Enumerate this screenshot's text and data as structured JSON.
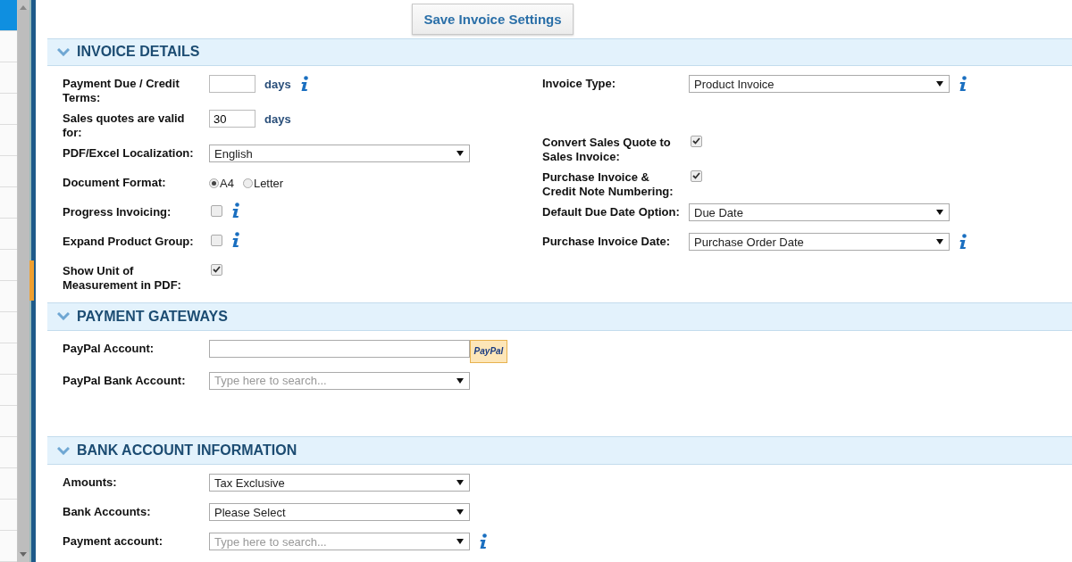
{
  "side_list": {
    "items": [
      {
        "selected": true
      },
      {
        "selected": false
      },
      {
        "selected": false
      },
      {
        "selected": false
      },
      {
        "selected": false
      },
      {
        "selected": false
      },
      {
        "selected": false
      },
      {
        "selected": false
      },
      {
        "selected": false
      },
      {
        "selected": false
      },
      {
        "selected": false
      },
      {
        "selected": false
      },
      {
        "selected": false
      },
      {
        "selected": false
      },
      {
        "selected": false
      },
      {
        "selected": false
      },
      {
        "selected": false
      },
      {
        "selected": false
      }
    ]
  },
  "save_button": "Save Invoice Settings",
  "sections": [
    {
      "title": "INVOICE DETAILS",
      "expanded": true,
      "columns": [
        [
          {
            "kind": "days",
            "label": "Payment Due / Credit Terms:",
            "unit": "days",
            "info": true
          },
          {
            "kind": "days",
            "label": "Sales quotes are valid for:",
            "value": "30",
            "unit": "days"
          },
          {
            "kind": "select",
            "label": "PDF/Excel Localization:",
            "value": "English"
          },
          {
            "kind": "radio",
            "label": "Document Format:",
            "options": [
              {
                "label": "A4",
                "selected": true
              },
              {
                "label": "Letter",
                "selected": false
              }
            ]
          },
          {
            "kind": "checkbox",
            "label": "Progress Invoicing:",
            "checked": false,
            "info": true
          },
          {
            "kind": "checkbox",
            "label": "Expand Product Group:",
            "checked": false,
            "info": true
          },
          {
            "kind": "checkbox",
            "label": "Show Unit of Measurement in PDF:",
            "checked": true
          }
        ],
        [
          {
            "kind": "select",
            "label": "Invoice Type:",
            "value": "Product Invoice",
            "info": true
          },
          {
            "kind": "checkbox",
            "label": "Convert Sales Quote to Sales Invoice:",
            "checked": true
          },
          {
            "kind": "checkbox",
            "label": "Purchase Invoice & Credit Note Numbering:",
            "checked": true
          },
          {
            "kind": "select",
            "label": "Default Due Date Option:",
            "value": "Due Date"
          },
          {
            "kind": "select",
            "label": "Purchase Invoice Date:",
            "value": "Purchase Order Date",
            "info": true
          }
        ]
      ]
    },
    {
      "title": "PAYMENT GATEWAYS",
      "expanded": true,
      "columns": [
        [
          {
            "kind": "paypal",
            "label": "PayPal Account:",
            "badge": "PayPal"
          },
          {
            "kind": "search",
            "label": "PayPal Bank Account:",
            "placeholder": "Type here to search..."
          }
        ]
      ]
    },
    {
      "title": "BANK ACCOUNT INFORMATION",
      "expanded": true,
      "columns": [
        [
          {
            "kind": "select",
            "label": "Amounts:",
            "value": "Tax Exclusive"
          },
          {
            "kind": "select",
            "label": "Bank Accounts:",
            "value": "Please Select"
          },
          {
            "kind": "search",
            "label": "Payment account:",
            "placeholder": "Type here to search...",
            "info": true
          }
        ]
      ]
    }
  ]
}
